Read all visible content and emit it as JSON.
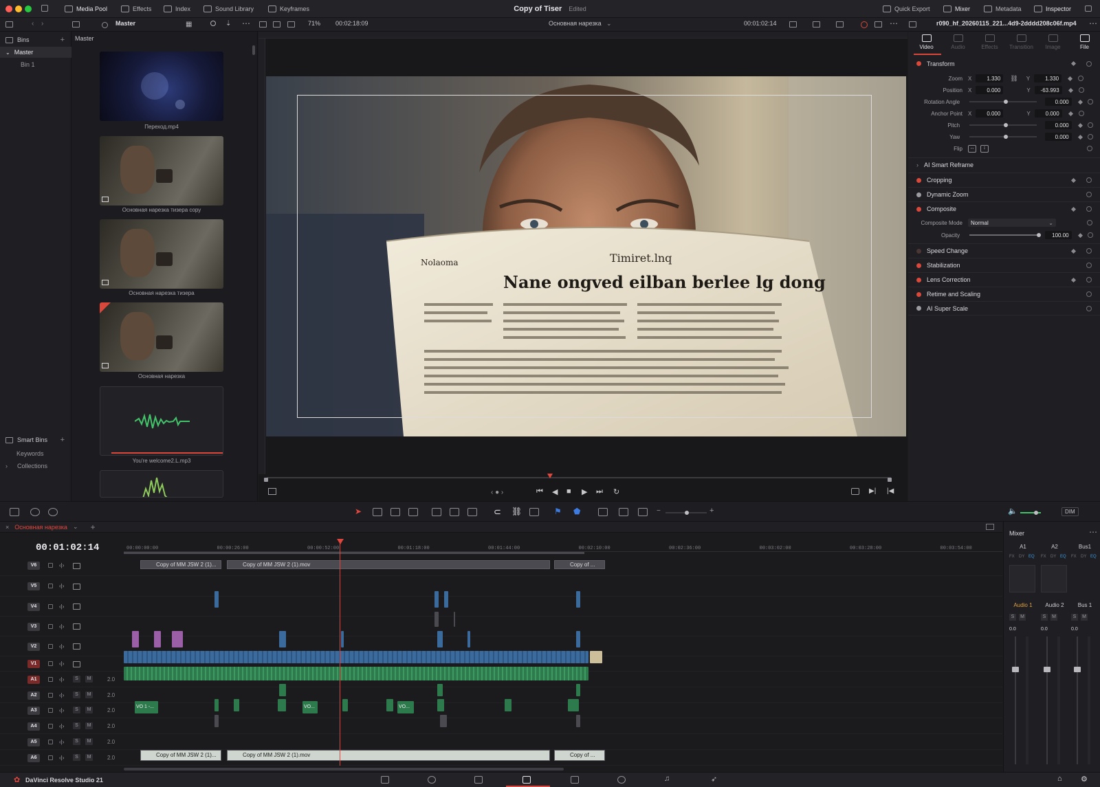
{
  "topbar": {
    "media_pool": "Media Pool",
    "effects": "Effects",
    "index": "Index",
    "sound_library": "Sound Library",
    "keyframes": "Keyframes",
    "project_title": "Copy of Tiser",
    "project_state": "Edited",
    "quick_export": "Quick Export",
    "mixer": "Mixer",
    "metadata": "Metadata",
    "inspector": "Inspector"
  },
  "toolbar2": {
    "bin_name": "Master",
    "zoom": "71%",
    "source_timecode": "00:02:18:09",
    "timeline_name": "Основная нарезка",
    "record_timecode": "00:01:02:14",
    "clip_filename": "r090_hf_20260115_221...4d9-2dddd208c06f.mp4"
  },
  "bins": {
    "header": "Bins",
    "master": "Master",
    "bin1": "Bin 1",
    "smart_bins": "Smart Bins",
    "keywords": "Keywords",
    "collections": "Collections"
  },
  "media_pool": {
    "header": "Master",
    "clips": [
      {
        "name": "Переход.mp4"
      },
      {
        "name": "Основная нарезка тизера copy"
      },
      {
        "name": "Основная нарезка тизера"
      },
      {
        "name": "Основная нарезка"
      },
      {
        "name": "You're welcome2.L.mp3"
      }
    ]
  },
  "viewer": {
    "newspaper_headline": "Nane ongved eilban berlee lg dong",
    "newspaper_masthead": "Timiret.lnq",
    "newspaper_sub": "Nolaoma"
  },
  "inspector": {
    "tabs": [
      "Video",
      "Audio",
      "Effects",
      "Transition",
      "Image",
      "File"
    ],
    "transform": "Transform",
    "zoom_label": "Zoom",
    "zoom_x": "1.330",
    "zoom_y": "1.330",
    "position_label": "Position",
    "position_x": "0.000",
    "position_y": "-63.993",
    "rotation_label": "Rotation Angle",
    "rotation": "0.000",
    "anchor_label": "Anchor Point",
    "anchor_x": "0.000",
    "anchor_y": "0.000",
    "pitch_label": "Pitch",
    "pitch": "0.000",
    "yaw_label": "Yaw",
    "yaw": "0.000",
    "flip_label": "Flip",
    "ai_reframe": "AI Smart Reframe",
    "cropping": "Cropping",
    "dynamic_zoom": "Dynamic Zoom",
    "composite": "Composite",
    "composite_mode_label": "Composite Mode",
    "composite_mode": "Normal",
    "opacity_label": "Opacity",
    "opacity": "100.00",
    "speed_change": "Speed Change",
    "stabilization": "Stabilization",
    "lens_correction": "Lens Correction",
    "retime": "Retime and Scaling",
    "super_scale": "AI Super Scale",
    "x": "X",
    "y": "Y"
  },
  "timeline": {
    "tab_name": "Основная нарезка",
    "timecode": "00:01:02:14",
    "ruler": [
      "00:00:00:00",
      "00:00:26:00",
      "00:00:52:00",
      "00:01:18:00",
      "00:01:44:00",
      "00:02:10:00",
      "00:02:36:00",
      "00:03:02:00",
      "00:03:28:00",
      "00:03:54:00"
    ],
    "video_tracks": [
      "V6",
      "V5",
      "V4",
      "V3",
      "V2",
      "V1"
    ],
    "audio_tracks": [
      "A1",
      "A2",
      "A3",
      "A4",
      "A5",
      "A6"
    ],
    "audio_level": "2.0",
    "solo": "S",
    "mute": "M",
    "clip_v6_1": "Copy of MM JSW 2 (1)...",
    "clip_v6_2": "Copy of MM JSW 2 (1).mov",
    "clip_v6_3": "Copy of ...",
    "clip_a6_1": "Copy of MM JSW 2 (1)...",
    "clip_a6_2": "Copy of MM JSW 2 (1).mov",
    "clip_a6_3": "Copy of ...",
    "vo1": "VO 1 -...",
    "vo2": "VO...",
    "vo3": "VO..."
  },
  "mixer": {
    "title": "Mixer",
    "channels": [
      "A1",
      "A2",
      "Bus1"
    ],
    "channel_names": [
      "Audio 1",
      "Audio 2",
      "Bus 1"
    ],
    "fx": "FX",
    "dy": "DY",
    "eq": "EQ",
    "level": "0.0",
    "dim": "DIM"
  },
  "app": {
    "name": "DaVinci Resolve Studio 21"
  },
  "colors": {
    "accent_red": "#e0463e",
    "video_clip": "#3b6a9c",
    "audio_clip": "#2d7a4c",
    "purple_clip": "#9b5fa8"
  }
}
